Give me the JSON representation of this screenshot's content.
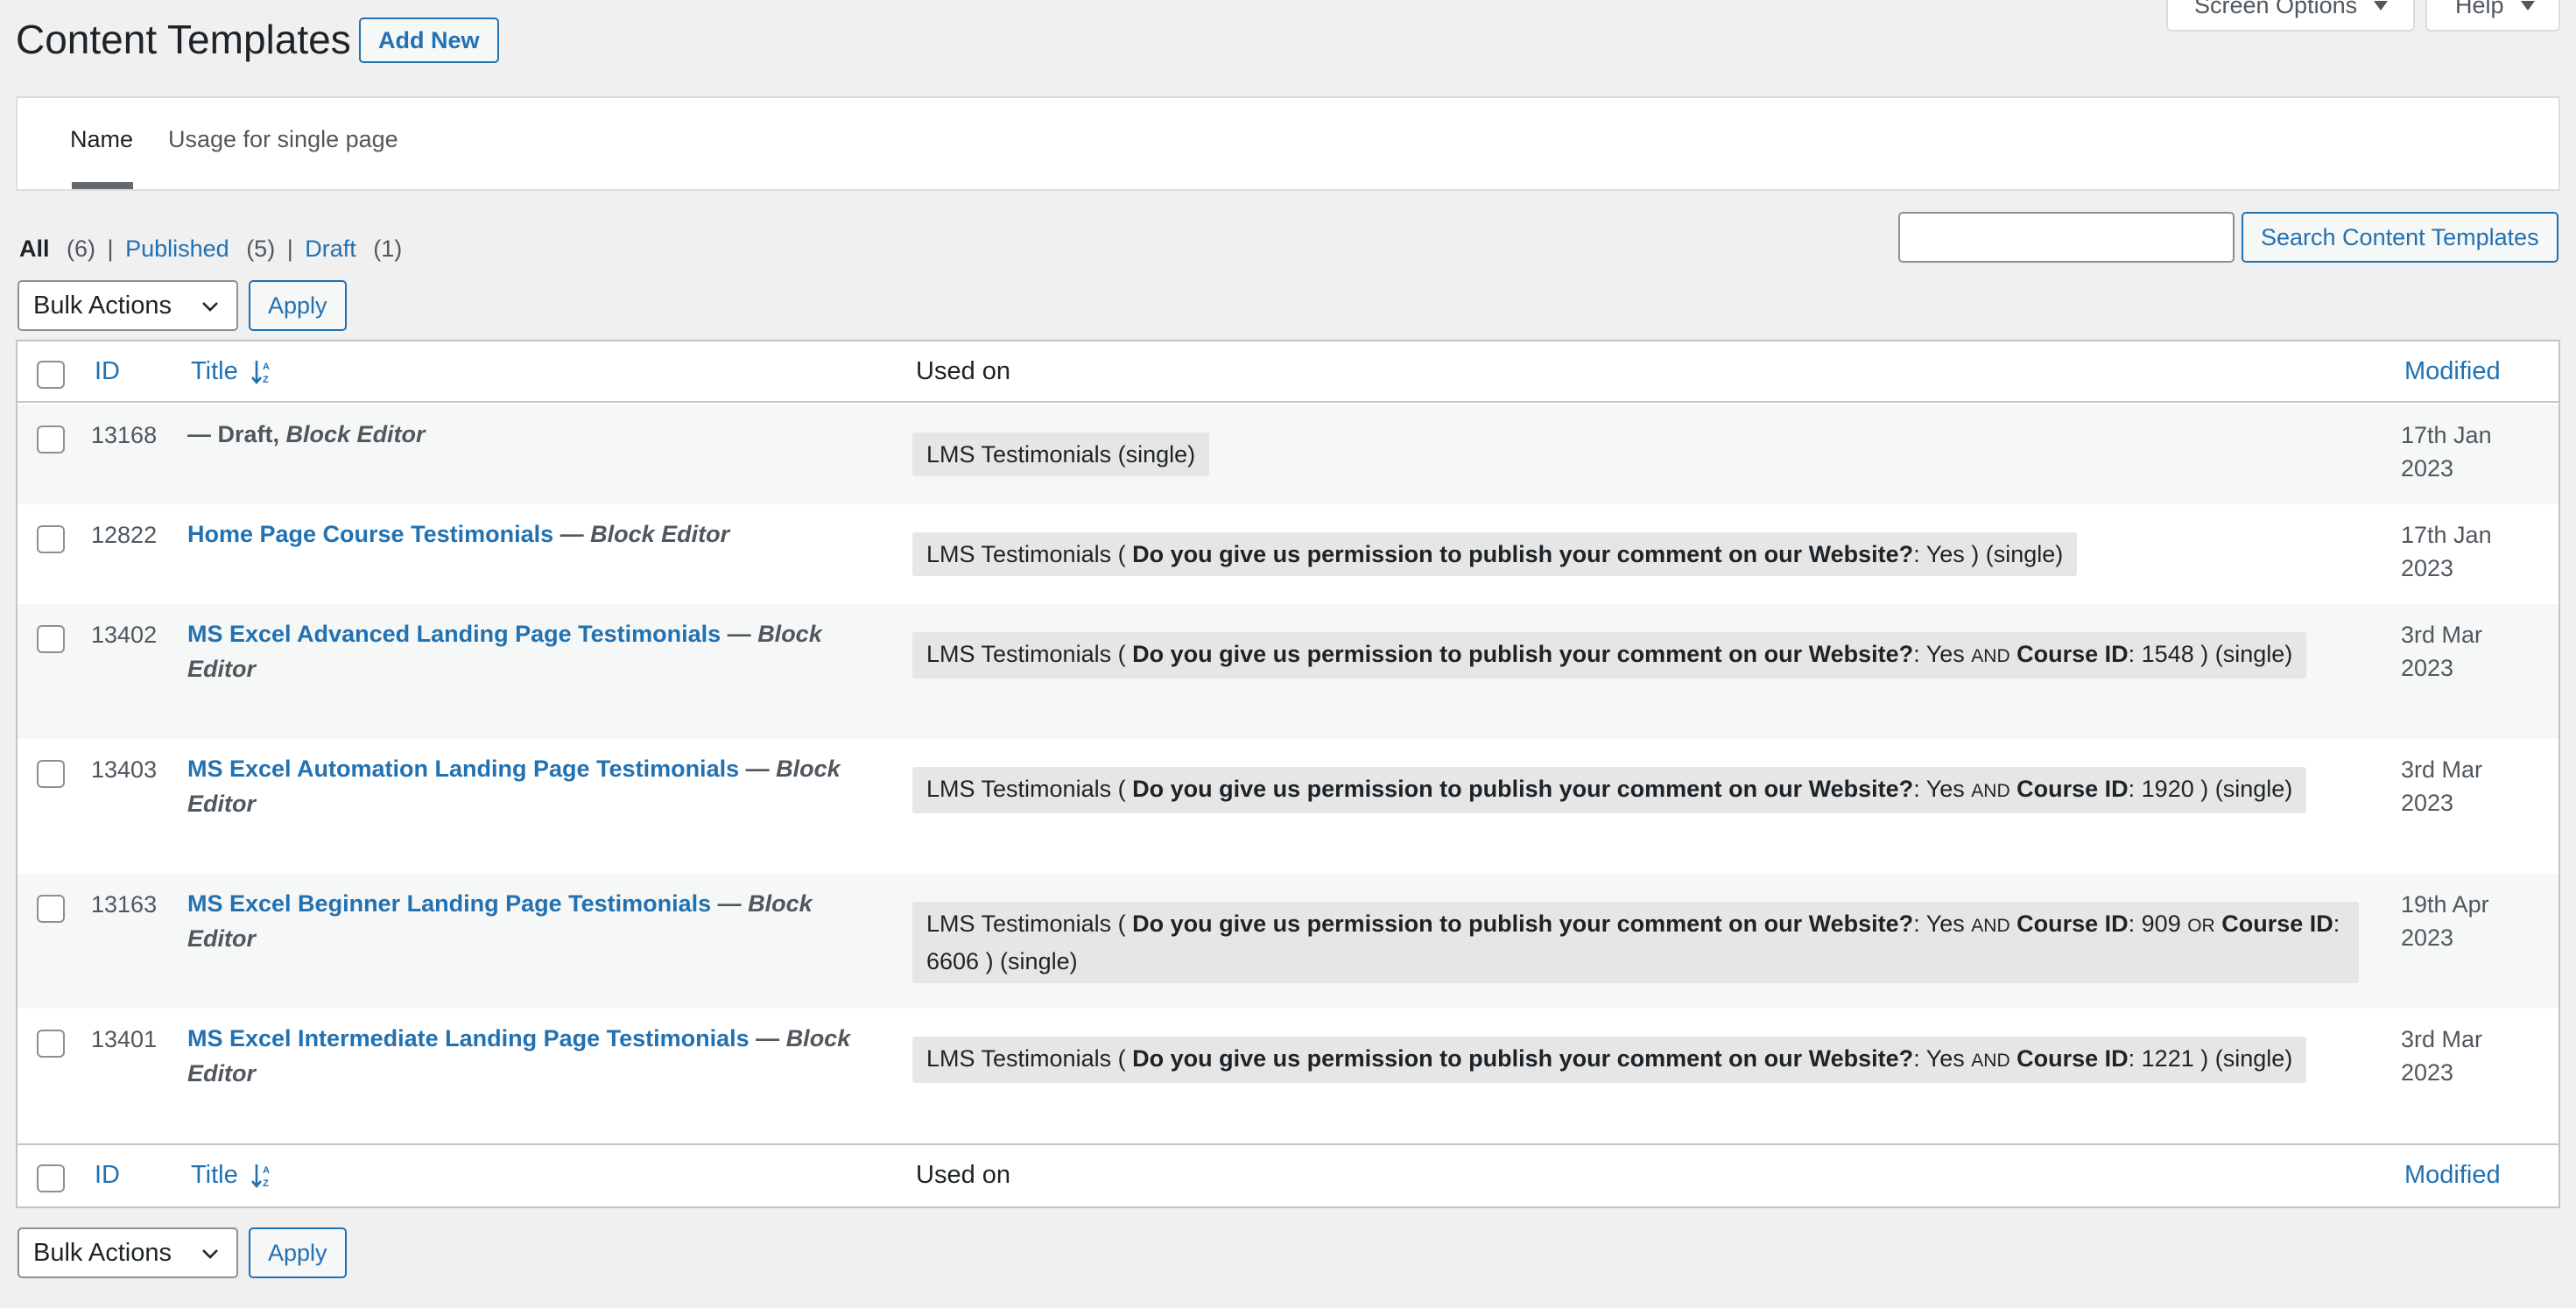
{
  "header": {
    "title": "Content Templates",
    "add_new": "Add New",
    "screen_options": "Screen Options",
    "help": "Help"
  },
  "tabs": [
    {
      "label": "Name",
      "active": true
    },
    {
      "label": "Usage for single page",
      "active": false
    }
  ],
  "filters": {
    "all_label": "All",
    "all_count": "(6)",
    "published_label": "Published",
    "published_count": "(5)",
    "draft_label": "Draft",
    "draft_count": "(1)",
    "sep": "|"
  },
  "search": {
    "placeholder": "",
    "button": "Search Content Templates"
  },
  "bulk": {
    "selected": "Bulk Actions",
    "apply": "Apply"
  },
  "table": {
    "columns": {
      "id": "ID",
      "title": "Title",
      "used_on": "Used on",
      "modified": "Modified"
    },
    "rows": [
      {
        "id": "13168",
        "title": "",
        "state": "— Draft,",
        "editor": "Block Editor",
        "usage_lines": [
          [
            "LMS Testimonials (single)"
          ]
        ],
        "modified_line1": "17th Jan",
        "modified_line2": "2023"
      },
      {
        "id": "12822",
        "title": "Home Page Course Testimonials",
        "sep": " — ",
        "editor": "Block Editor",
        "usage_prefix": "LMS Testimonials ( ",
        "usage_q": "Do you give us permission to publish your comment on our Website?",
        "usage_val": ": Yes ) (single)",
        "modified_line1": "17th Jan",
        "modified_line2": "2023"
      },
      {
        "id": "13402",
        "title": "MS Excel Advanced Landing Page Testimonials",
        "sep": " — ",
        "editor_1": "Block",
        "editor_2": "Editor",
        "usage_prefix": "LMS Testimonials ( ",
        "usage_q": "Do you give us permission to publish your comment on our Website?",
        "usage_mid": ": Yes ",
        "usage_and": "AND",
        "usage_cid": "Course ID",
        "usage_end": ": 1548 ) (single)",
        "modified_line1": "3rd Mar",
        "modified_line2": "2023"
      },
      {
        "id": "13403",
        "title": "MS Excel Automation Landing Page Testimonials",
        "sep": " — ",
        "editor_1": "Block",
        "editor_2": "Editor",
        "usage_prefix": "LMS Testimonials ( ",
        "usage_q": "Do you give us permission to publish your comment on our Website?",
        "usage_mid": ": Yes ",
        "usage_and": "AND",
        "usage_cid": "Course ID",
        "usage_end": ": 1920 ) (single)",
        "modified_line1": "3rd Mar",
        "modified_line2": "2023"
      },
      {
        "id": "13163",
        "title": "MS Excel Beginner Landing Page Testimonials",
        "sep": " — ",
        "editor_1": "Block",
        "editor_2": "Editor",
        "usage_prefix": "LMS Testimonials ( ",
        "usage_q": "Do you give us permission to publish your comment on our Website?",
        "usage_mid": ": Yes ",
        "usage_and": "AND",
        "usage_cid": "Course ID",
        "usage_mid2": ": 909 ",
        "usage_or": "OR",
        "usage_cid2": "Course ID",
        "usage_colon": ":",
        "usage_line2": "6606 ) (single)",
        "modified_line1": "19th Apr",
        "modified_line2": "2023"
      },
      {
        "id": "13401",
        "title": "MS Excel Intermediate Landing Page Testimonials",
        "sep": " — ",
        "editor_1": "Block",
        "editor_2": "Editor",
        "usage_prefix": "LMS Testimonials ( ",
        "usage_q": "Do you give us permission to publish your comment on our Website?",
        "usage_mid": ": Yes ",
        "usage_and": "AND",
        "usage_cid": "Course ID",
        "usage_end": ": 1221 ) (single)",
        "modified_line1": "3rd Mar",
        "modified_line2": "2023"
      }
    ]
  },
  "colors": {
    "link": "#2271b1",
    "background": "#f0f0f1",
    "usage_chip": "#e6e6e6",
    "stripe": "#f6f7f7"
  },
  "icons": {
    "sort": "sort-alpha-icon",
    "dropdown": "chevron-down-icon",
    "caret": "caret-down-icon"
  }
}
